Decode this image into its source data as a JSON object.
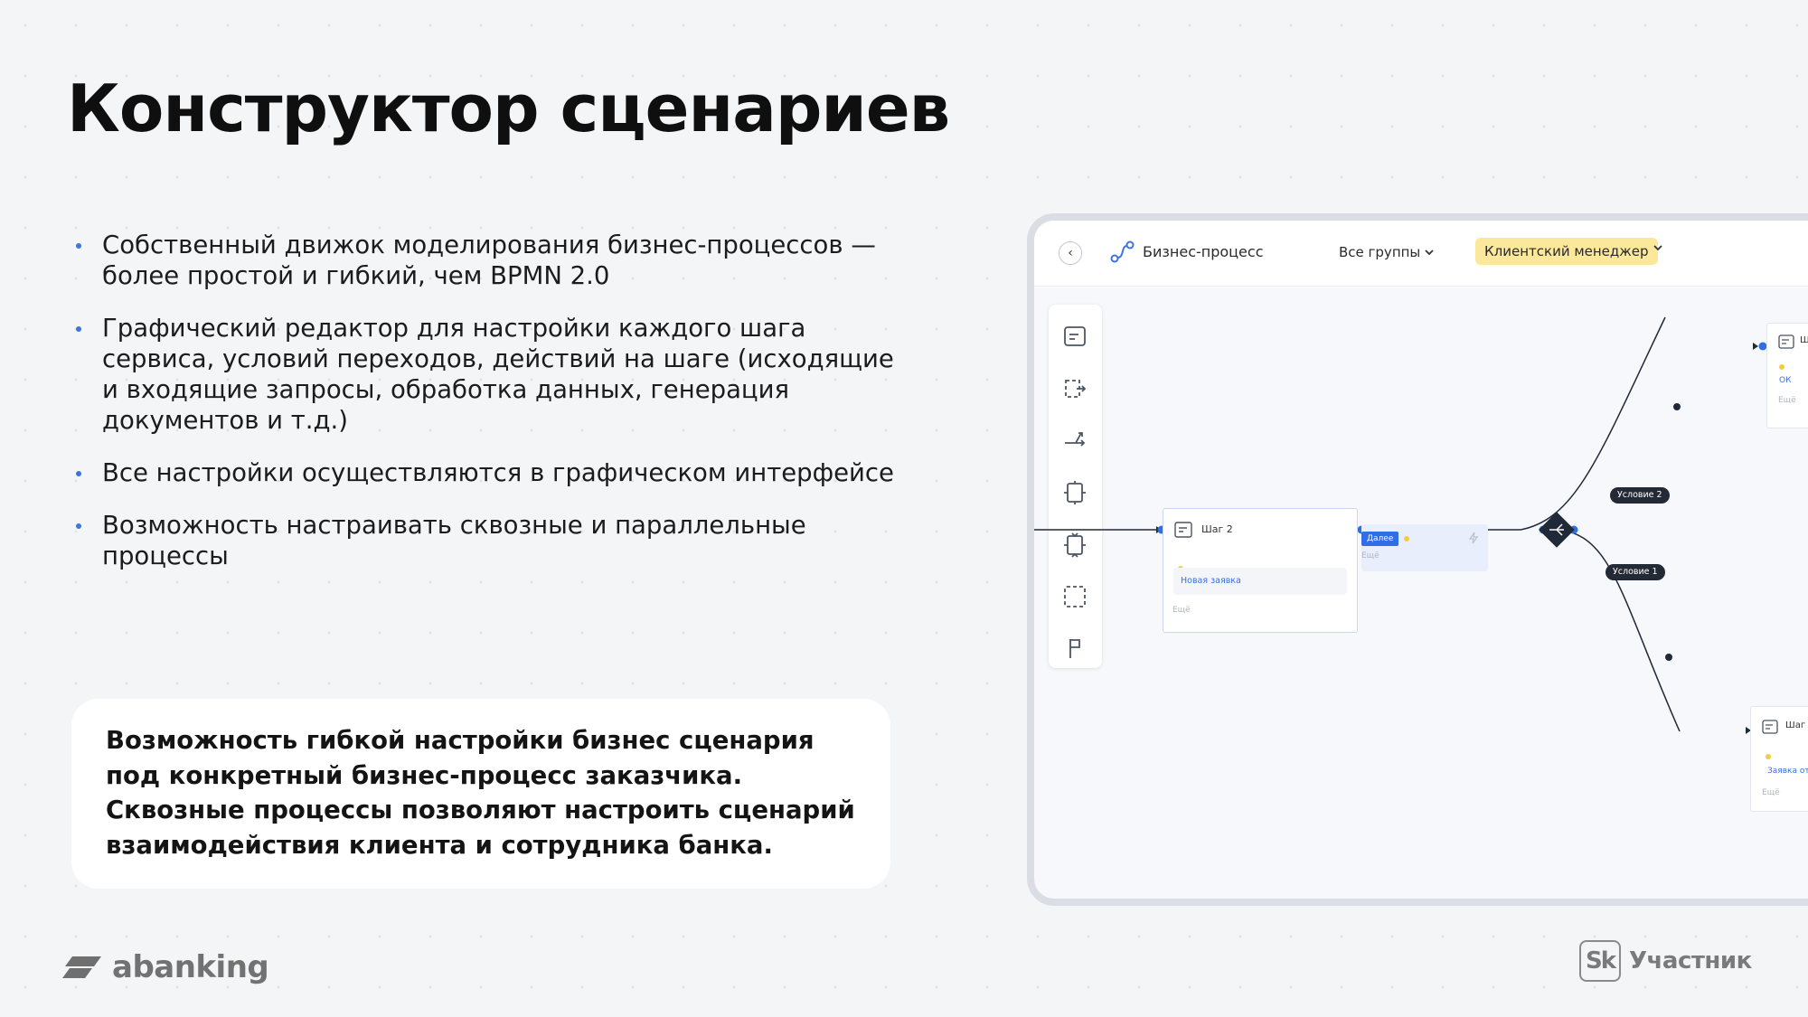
{
  "slide": {
    "title": "Конструктор сценариев",
    "bullets": [
      {
        "lines": [
          "Собственный движок моделирования бизнес-процессов —",
          "более простой и гибкий, чем BPMN 2.0"
        ]
      },
      {
        "lines": [
          "Графический редактор для настройки каждого шага",
          "сервиса, условий переходов, действий на шаге (исходящие",
          "и входящие запросы, обработка данных, генерация",
          "документов и т.д.)"
        ]
      },
      {
        "lines": [
          "Все настройки осуществляются в графическом интерфейсе"
        ]
      },
      {
        "lines": [
          "Возможность настраивать сквозные и параллельные",
          "процессы"
        ]
      }
    ],
    "callout": {
      "lines": [
        "Возможность гибкой настройки бизнес сценария",
        "под конкретный бизнес-процесс заказчика.",
        "Сквозные процессы позволяют настроить сценарий",
        "взаимодействия клиента и сотрудника банка."
      ]
    }
  },
  "footer": {
    "brand": "abanking",
    "badge_letters": "Sk",
    "badge_text": "Участник"
  },
  "app": {
    "header": {
      "title": "Бизнес-процесс",
      "groups_label": "Все группы",
      "role_label": "Клиентский менеджер"
    },
    "toolbar": [
      {
        "icon": "step-node-icon"
      },
      {
        "icon": "subprocess-icon"
      },
      {
        "icon": "branch-icon"
      },
      {
        "icon": "parallel-start-icon"
      },
      {
        "icon": "parallel-end-icon"
      },
      {
        "icon": "group-select-icon"
      },
      {
        "icon": "finish-flag-icon"
      }
    ],
    "canvas": {
      "step2": {
        "title": "Шаг 2",
        "field": "Новая заявка",
        "more": "Ещё"
      },
      "next_chip": "Далее",
      "next_more": "Ещё",
      "condition_2": "Условие 2",
      "condition_1": "Условие 1",
      "top_right_node": {
        "title": "Ш",
        "field": "ОК",
        "more": "Ещё"
      },
      "bottom_right_node": {
        "title": "Шаг",
        "field": "Заявка от",
        "more": "Ещё"
      }
    },
    "colors": {
      "accent": "#2f6ee3",
      "role_highlight": "#fbe89a",
      "condition_pill": "#242a35"
    }
  }
}
